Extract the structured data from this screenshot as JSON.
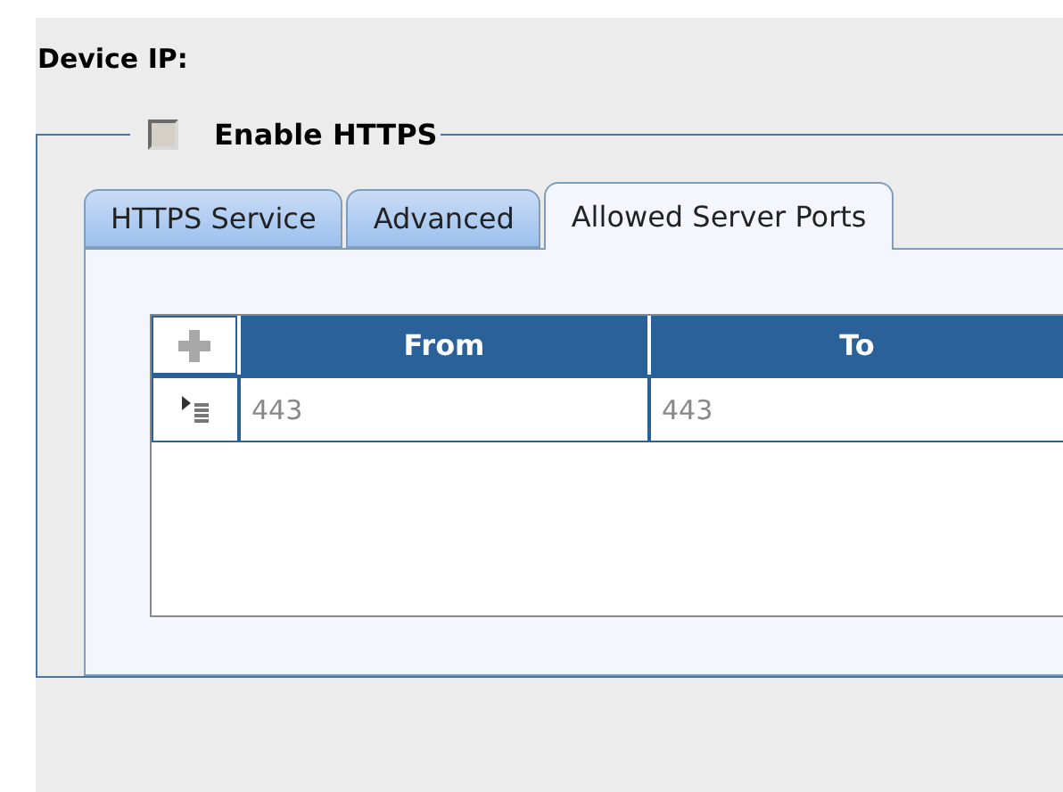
{
  "device_ip_label": "Device IP:",
  "https": {
    "label": "Enable HTTPS",
    "checked": false
  },
  "tabs": [
    {
      "label": "HTTPS Service",
      "selected": false
    },
    {
      "label": "Advanced",
      "selected": false
    },
    {
      "label": "Allowed Server Ports",
      "selected": true
    }
  ],
  "table": {
    "columns": [
      "From",
      "To"
    ],
    "rows": [
      [
        "443",
        "443"
      ]
    ]
  }
}
